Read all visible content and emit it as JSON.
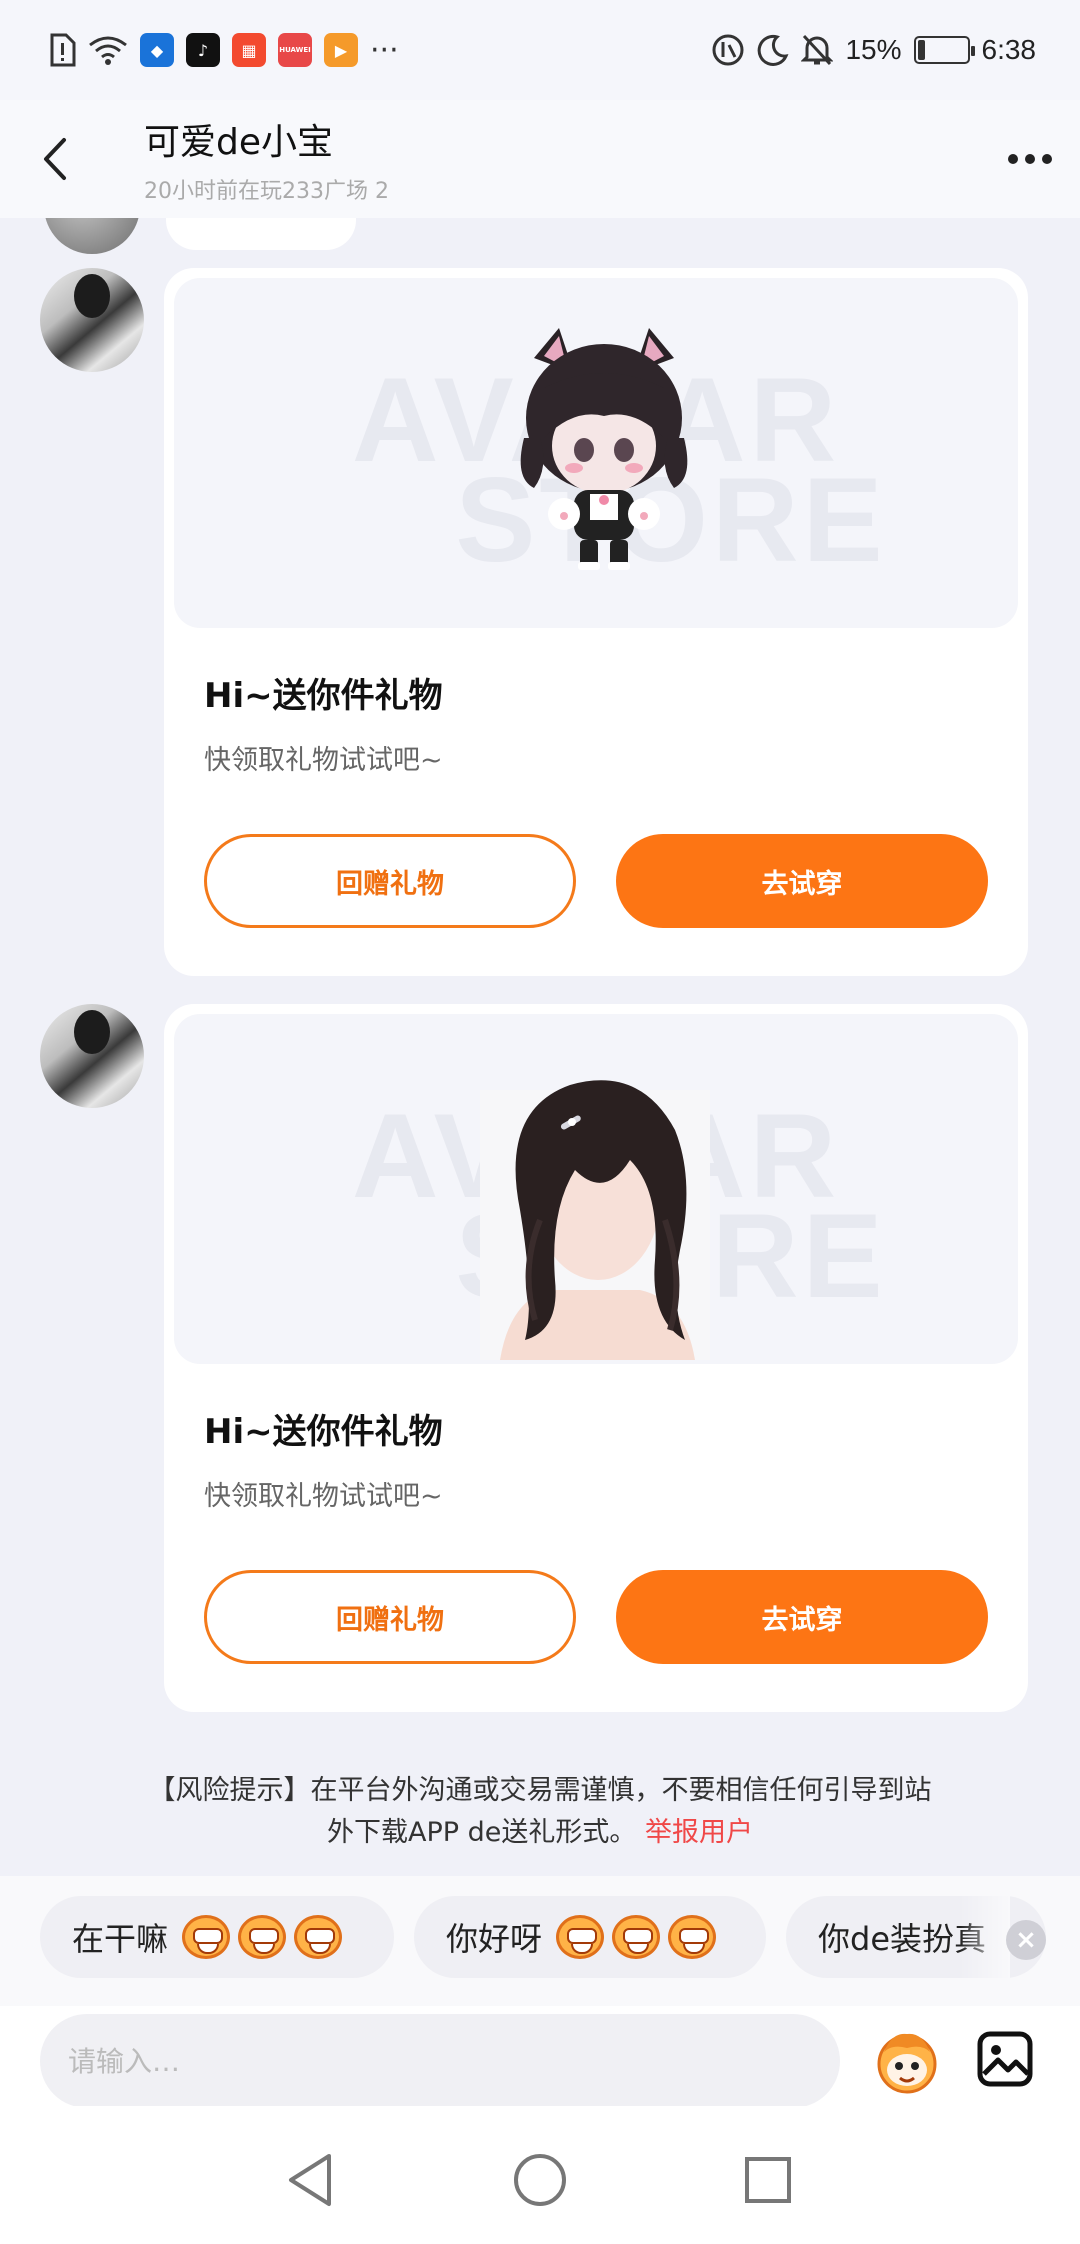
{
  "status_bar": {
    "battery_percent": "15%",
    "time": "6:38",
    "overflow": "···",
    "huawei_label": "HUAWEI"
  },
  "header": {
    "title": "可爱de小宝",
    "subtitle": "20小时前在玩233广场 2"
  },
  "messages": [
    {
      "watermark_line1": "AVATAR",
      "watermark_line2": "STORE",
      "title": "Hi~送你件礼物",
      "subtitle": "快领取礼物试试吧~",
      "return_gift_label": "回赠礼物",
      "try_on_label": "去试穿"
    },
    {
      "watermark_line1": "AVATAR",
      "watermark_line2": "STORE",
      "title": "Hi~送你件礼物",
      "subtitle": "快领取礼物试试吧~",
      "return_gift_label": "回赠礼物",
      "try_on_label": "去试穿"
    }
  ],
  "risk_notice": {
    "line1": "【风险提示】在平台外沟通或交易需谨慎，不要相信任何引导到站",
    "line2": "外下载APP de送礼形式。",
    "report_link": "举报用户"
  },
  "quick_replies": [
    {
      "text": "在干嘛"
    },
    {
      "text": "你好呀"
    },
    {
      "text": "你de装扮真"
    }
  ],
  "quick_close": "×",
  "input": {
    "placeholder": "请输入…"
  },
  "colors": {
    "accent": "#fd7514",
    "link": "#f04848",
    "background": "#f0f1f8"
  }
}
